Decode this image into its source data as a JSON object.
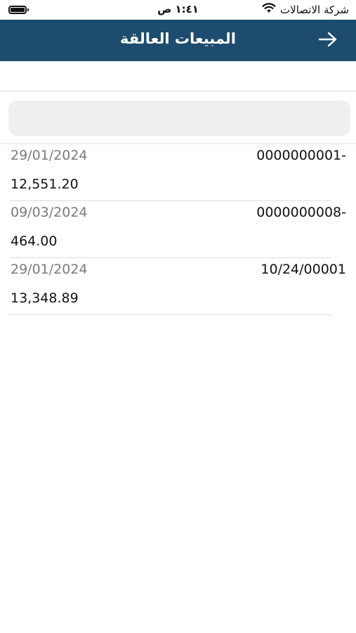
{
  "status_bar": {
    "carrier": "شركة الاتصالات",
    "time": "١:٤١ ص"
  },
  "header": {
    "title": "المبيعات العالقة",
    "back_icon": "arrow-right-icon"
  },
  "search": {
    "placeholder": ""
  },
  "items": [
    {
      "number": "0000000001-",
      "date": "29/01/2024",
      "amount": "12,551.20"
    },
    {
      "number": "0000000008-",
      "date": "09/03/2024",
      "amount": "464.00"
    },
    {
      "number": "10/24/00001",
      "date": "29/01/2024",
      "amount": "13,348.89"
    }
  ],
  "colors": {
    "nav_background": "#1e4c6e",
    "nav_text": "#ffffff",
    "date_text": "#7a7a7a",
    "search_background": "#efefef"
  }
}
